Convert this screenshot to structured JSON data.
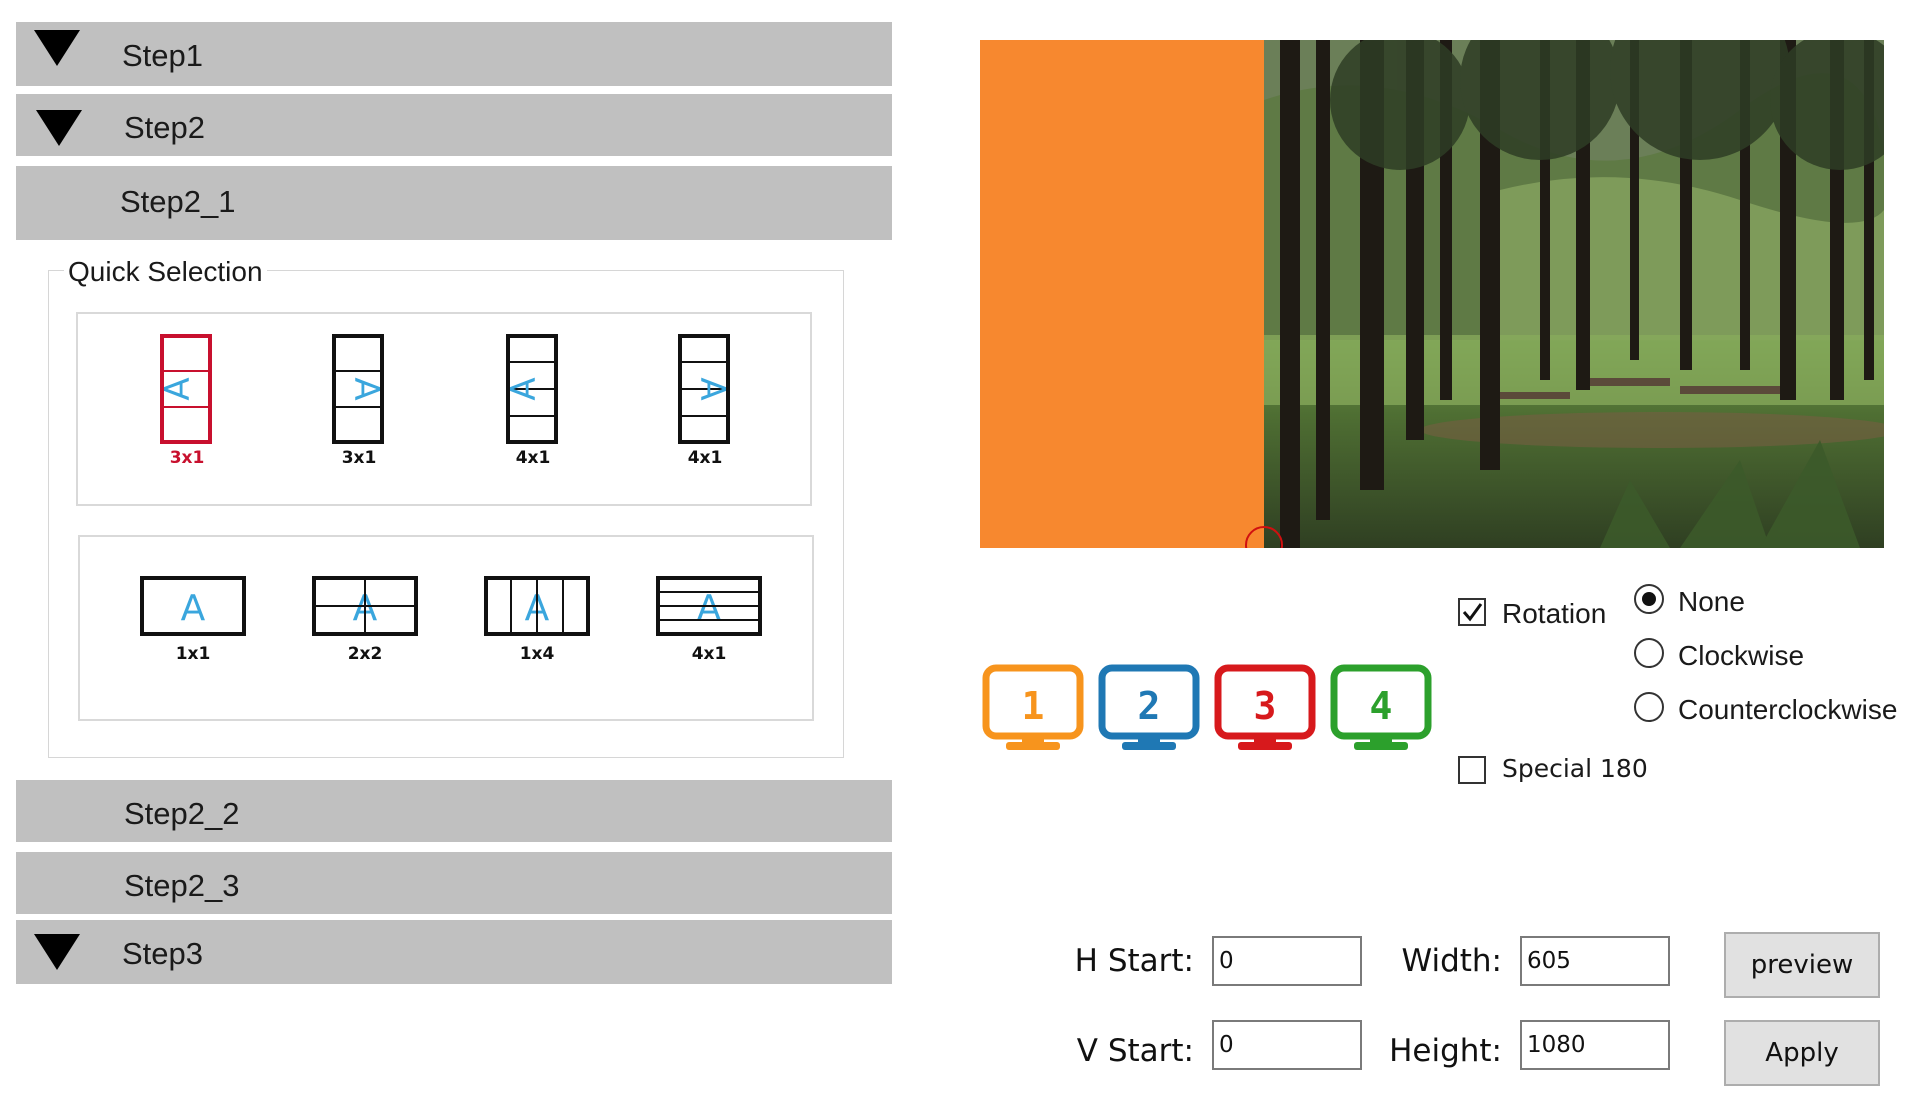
{
  "accordion": {
    "step1": "Step1",
    "step2": "Step2",
    "step2_1": "Step2_1",
    "step2_2": "Step2_2",
    "step2_3": "Step2_3",
    "step3": "Step3"
  },
  "quick_selection": {
    "title": "Quick Selection",
    "rotated_layouts": [
      {
        "label": "3x1",
        "selected": true,
        "color": "#c8102e"
      },
      {
        "label": "3x1",
        "selected": false
      },
      {
        "label": "4x1",
        "selected": false
      },
      {
        "label": "4x1",
        "selected": false
      }
    ],
    "upright_layouts": [
      {
        "label": "1x1"
      },
      {
        "label": "2x2"
      },
      {
        "label": "1x4"
      },
      {
        "label": "4x1"
      }
    ]
  },
  "preview": {
    "overlay_color": "#f7882f"
  },
  "monitors": [
    {
      "number": "1",
      "color": "#f7941d"
    },
    {
      "number": "2",
      "color": "#1f78b4"
    },
    {
      "number": "3",
      "color": "#d7191c"
    },
    {
      "number": "4",
      "color": "#2ca02c"
    }
  ],
  "rotation": {
    "checkbox_label": "Rotation",
    "checked": true,
    "options": [
      "None",
      "Clockwise",
      "Counterclockwise"
    ],
    "selected": "None",
    "special_label": "Special 180",
    "special_checked": false
  },
  "geometry": {
    "h_start_label": "H Start:",
    "h_start_value": "0",
    "v_start_label": "V Start:",
    "v_start_value": "0",
    "width_label": "Width:",
    "width_value": "605",
    "height_label": "Height:",
    "height_value": "1080"
  },
  "buttons": {
    "preview": "preview",
    "apply": "Apply"
  }
}
